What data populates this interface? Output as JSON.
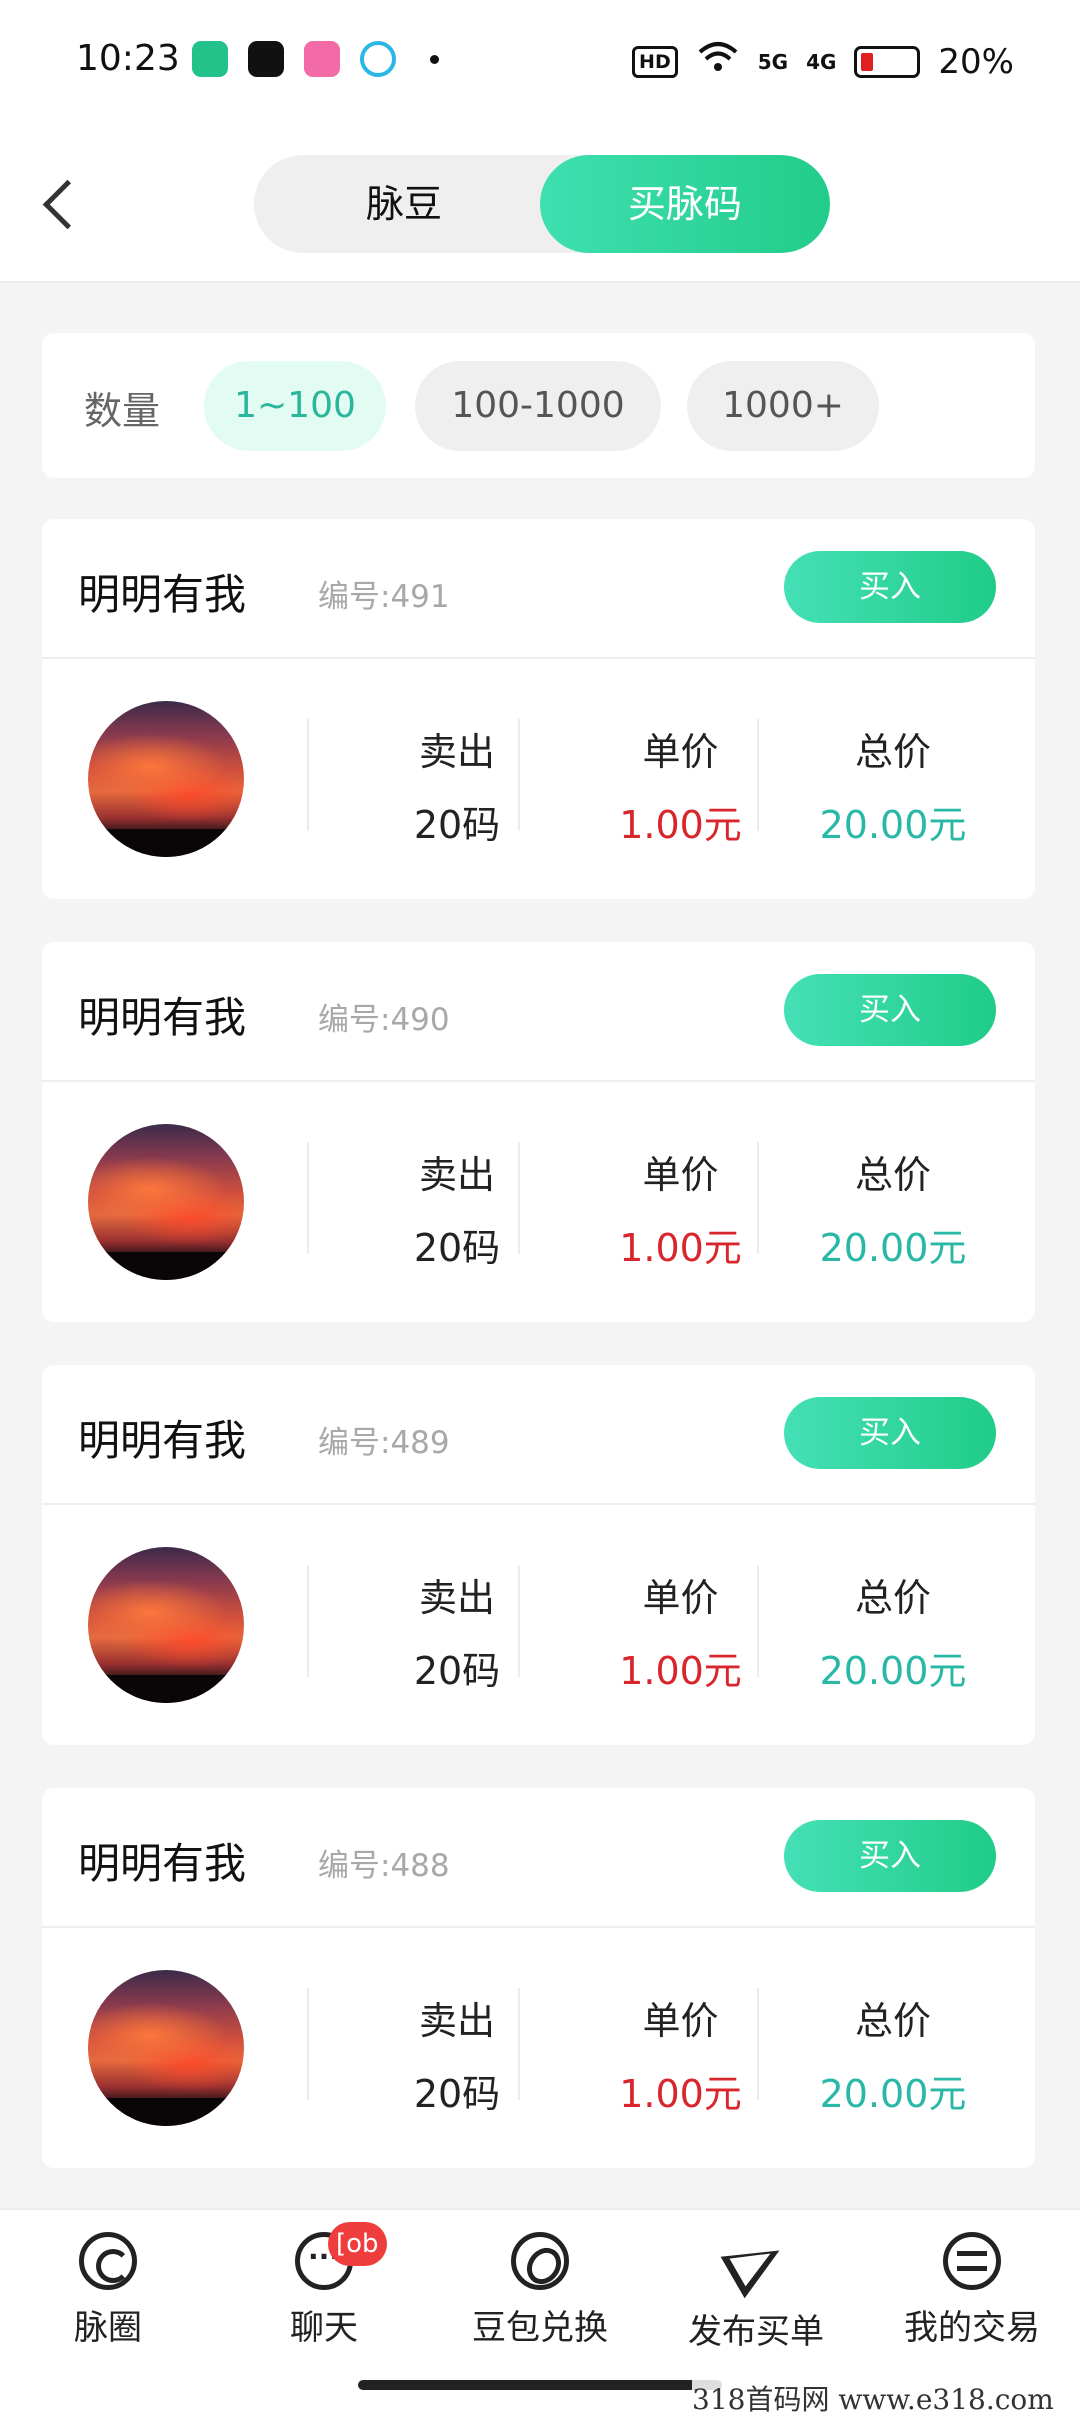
{
  "status_bar": {
    "time": "10:23",
    "hd": "HD",
    "net1": "5G",
    "net2": "4G",
    "battery": "20%"
  },
  "header": {
    "tabs": [
      {
        "label": "脉豆",
        "active": false
      },
      {
        "label": "买脉码",
        "active": true
      }
    ]
  },
  "filter": {
    "label": "数量",
    "options": [
      {
        "label": "1~100",
        "active": true
      },
      {
        "label": "100-1000",
        "active": false
      },
      {
        "label": "1000+",
        "active": false
      }
    ]
  },
  "columns": {
    "sold": "卖出",
    "unit_price": "单价",
    "total": "总价"
  },
  "buy_label": "买入",
  "listings": [
    {
      "seller": "明明有我",
      "serial": "编号:491",
      "sold": "20码",
      "unit_price": "1.00元",
      "total": "20.00元"
    },
    {
      "seller": "明明有我",
      "serial": "编号:490",
      "sold": "20码",
      "unit_price": "1.00元",
      "total": "20.00元"
    },
    {
      "seller": "明明有我",
      "serial": "编号:489",
      "sold": "20码",
      "unit_price": "1.00元",
      "total": "20.00元"
    },
    {
      "seller": "明明有我",
      "serial": "编号:488",
      "sold": "20码",
      "unit_price": "1.00元",
      "total": "20.00元"
    }
  ],
  "bottom_nav": [
    {
      "label": "脉圈",
      "icon": "circle-icon"
    },
    {
      "label": "聊天",
      "icon": "chat-icon",
      "badge": "[ob"
    },
    {
      "label": "豆包兑换",
      "icon": "bean-icon"
    },
    {
      "label": "发布买单",
      "icon": "send-icon"
    },
    {
      "label": "我的交易",
      "icon": "swap-icon"
    }
  ],
  "watermark": "318首码网 www.e318.com",
  "colors": {
    "accent": "#22cc8a",
    "accent_light": "#e2fbf3",
    "price_red": "#d8262c",
    "total_teal": "#2ab8a6"
  }
}
